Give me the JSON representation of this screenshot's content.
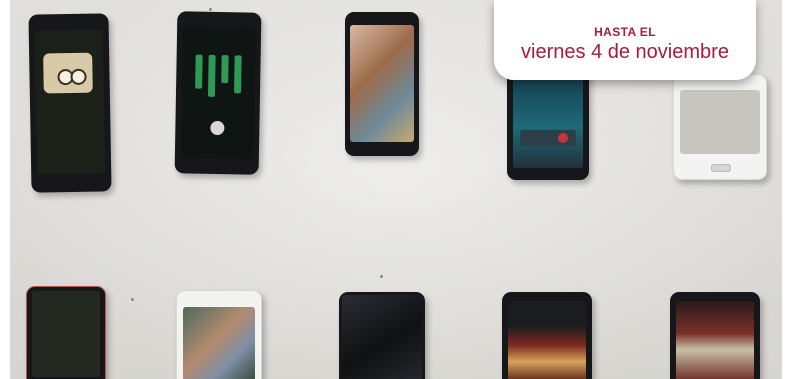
{
  "badge": {
    "kicker": "HASTA EL",
    "date": "viernes 4 de noviembre",
    "accent_color": "#a51d3a"
  },
  "photo": {
    "phones": [
      {
        "name": "phone-bread-illustration"
      },
      {
        "name": "phone-music-player"
      },
      {
        "name": "phone-cat-painting"
      },
      {
        "name": "phone-call-screen"
      },
      {
        "name": "phone-white-galaxy"
      },
      {
        "name": "phone-dark-left"
      },
      {
        "name": "phone-samsung-couple-painting"
      },
      {
        "name": "phone-blank-screen"
      },
      {
        "name": "phone-mecha-art"
      },
      {
        "name": "phone-red-artwork"
      }
    ]
  }
}
